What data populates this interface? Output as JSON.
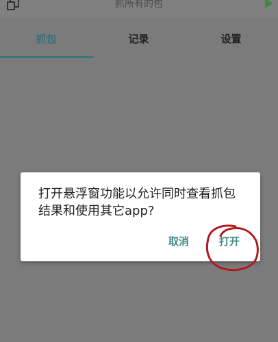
{
  "header": {
    "title": "抓所有的包"
  },
  "tabs": [
    {
      "label": "抓包",
      "active": true
    },
    {
      "label": "记录",
      "active": false
    },
    {
      "label": "设置",
      "active": false
    }
  ],
  "dialog": {
    "message": "打开悬浮窗功能以允许同时查看抓包结果和使用其它app?",
    "cancel_label": "取消",
    "confirm_label": "打开"
  },
  "colors": {
    "overlay": "#7b7b7b",
    "accent": "#3e7780",
    "button_text": "#3e8a83",
    "play_icon": "#3d8c3a",
    "annotation": "#b3191c"
  },
  "icons": {
    "left": "copy-icon",
    "right": "play-icon"
  }
}
